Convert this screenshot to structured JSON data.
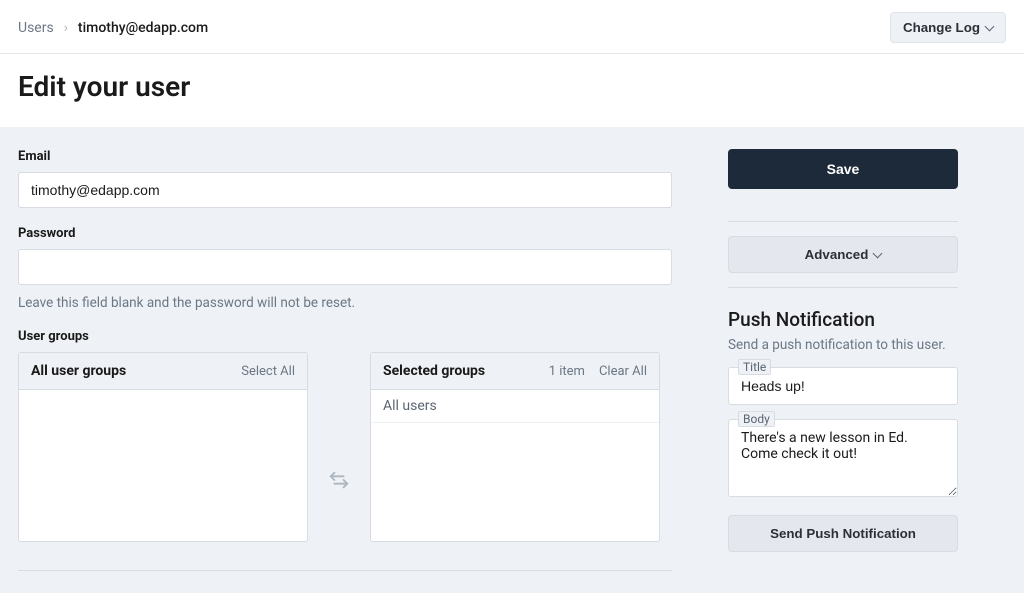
{
  "breadcrumb": {
    "root": "Users",
    "current": "timothy@edapp.com"
  },
  "header": {
    "change_log_label": "Change Log"
  },
  "page": {
    "title": "Edit your user"
  },
  "form": {
    "email_label": "Email",
    "email_value": "timothy@edapp.com",
    "password_label": "Password",
    "password_value": "",
    "password_help": "Leave this field blank and the password will not be reset.",
    "user_groups_label": "User groups"
  },
  "groups": {
    "all": {
      "title": "All user groups",
      "action": "Select All",
      "items": []
    },
    "selected": {
      "title": "Selected groups",
      "count_label": "1 item",
      "action": "Clear All",
      "items": [
        "All users"
      ]
    }
  },
  "sidebar": {
    "save_label": "Save",
    "advanced_label": "Advanced",
    "push": {
      "heading": "Push Notification",
      "sub": "Send a push notification to this user.",
      "title_label": "Title",
      "title_value": "Heads up!",
      "body_label": "Body",
      "body_value": "There's a new lesson in Ed. Come check it out!",
      "send_label": "Send Push Notification"
    }
  }
}
